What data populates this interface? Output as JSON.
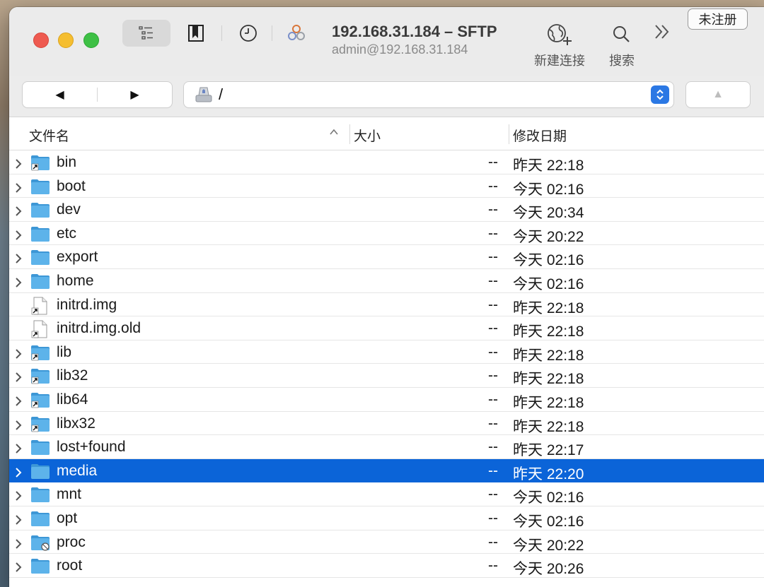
{
  "window": {
    "title": "192.168.31.184 – SFTP",
    "subtitle": "admin@192.168.31.184"
  },
  "toolbar": {
    "new_connection_label": "新建连接",
    "search_label": "搜索",
    "unregistered_label": "未注册"
  },
  "pathbar": {
    "back_glyph": "◀",
    "forward_glyph": "▶",
    "path": "/",
    "up_glyph": "▲"
  },
  "columns": {
    "name": "文件名",
    "size": "大小",
    "date": "修改日期"
  },
  "colors": {
    "selection": "#0b64d8",
    "folder": "#5db3ea",
    "accent": "#2b78e4"
  },
  "files": [
    {
      "name": "bin",
      "size": "--",
      "date": "昨天 22:18",
      "type": "folder-alias",
      "expandable": true,
      "selected": false
    },
    {
      "name": "boot",
      "size": "--",
      "date": "今天 02:16",
      "type": "folder",
      "expandable": true,
      "selected": false
    },
    {
      "name": "dev",
      "size": "--",
      "date": "今天 20:34",
      "type": "folder",
      "expandable": true,
      "selected": false
    },
    {
      "name": "etc",
      "size": "--",
      "date": "今天 20:22",
      "type": "folder",
      "expandable": true,
      "selected": false
    },
    {
      "name": "export",
      "size": "--",
      "date": "今天 02:16",
      "type": "folder",
      "expandable": true,
      "selected": false
    },
    {
      "name": "home",
      "size": "--",
      "date": "今天 02:16",
      "type": "folder",
      "expandable": true,
      "selected": false
    },
    {
      "name": "initrd.img",
      "size": "--",
      "date": "昨天 22:18",
      "type": "file-alias",
      "expandable": false,
      "selected": false
    },
    {
      "name": "initrd.img.old",
      "size": "--",
      "date": "昨天 22:18",
      "type": "file-alias",
      "expandable": false,
      "selected": false
    },
    {
      "name": "lib",
      "size": "--",
      "date": "昨天 22:18",
      "type": "folder-alias",
      "expandable": true,
      "selected": false
    },
    {
      "name": "lib32",
      "size": "--",
      "date": "昨天 22:18",
      "type": "folder-alias",
      "expandable": true,
      "selected": false
    },
    {
      "name": "lib64",
      "size": "--",
      "date": "昨天 22:18",
      "type": "folder-alias",
      "expandable": true,
      "selected": false
    },
    {
      "name": "libx32",
      "size": "--",
      "date": "昨天 22:18",
      "type": "folder-alias",
      "expandable": true,
      "selected": false
    },
    {
      "name": "lost+found",
      "size": "--",
      "date": "昨天 22:17",
      "type": "folder",
      "expandable": true,
      "selected": false
    },
    {
      "name": "media",
      "size": "--",
      "date": "昨天 22:20",
      "type": "folder",
      "expandable": true,
      "selected": true
    },
    {
      "name": "mnt",
      "size": "--",
      "date": "今天 02:16",
      "type": "folder",
      "expandable": true,
      "selected": false
    },
    {
      "name": "opt",
      "size": "--",
      "date": "今天 02:16",
      "type": "folder",
      "expandable": true,
      "selected": false
    },
    {
      "name": "proc",
      "size": "--",
      "date": "今天 20:22",
      "type": "folder-restricted",
      "expandable": true,
      "selected": false
    },
    {
      "name": "root",
      "size": "--",
      "date": "今天 20:26",
      "type": "folder",
      "expandable": true,
      "selected": false
    }
  ]
}
